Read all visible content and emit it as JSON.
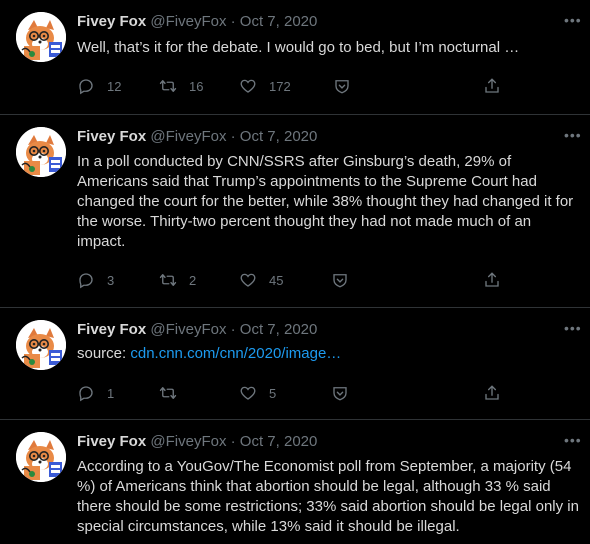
{
  "author": {
    "name": "Fivey Fox",
    "handle": "@FiveyFox",
    "separator": "·"
  },
  "more_glyph": "•••",
  "colors": {
    "background": "#000000",
    "text": "#d9d9d9",
    "muted": "#6e767d",
    "link": "#1d9bf0",
    "divider": "#2f3336"
  },
  "icons": {
    "reply": "reply-icon",
    "retweet": "retweet-icon",
    "like": "heart-icon",
    "save": "shield-icon",
    "share": "share-icon",
    "more": "more-icon"
  },
  "tweets": [
    {
      "date": "Oct 7, 2020",
      "text": "Well, that’s it for the debate. I would go to bed, but I’m nocturnal …",
      "replies": "12",
      "retweets": "16",
      "likes": "172"
    },
    {
      "date": "Oct 7, 2020",
      "text": "In a poll conducted by CNN/SSRS after Ginsburg’s death, 29% of Americans said that Trump’s appointments to the Supreme Court had changed the court for the better, while 38% thought they had changed it for the worse. Thirty-two percent thought they had not made much of an impact.",
      "replies": "3",
      "retweets": "2",
      "likes": "45"
    },
    {
      "date": "Oct 7, 2020",
      "text_prefix": "source: ",
      "link_text": "cdn.cnn.com/cnn/2020/image…",
      "replies": "1",
      "retweets": "",
      "likes": "5"
    },
    {
      "date": "Oct 7, 2020",
      "text": "According to a YouGov/The Economist poll from September, a majority (54 %) of Americans think that abortion should be legal, although 33 % said there should be some restrictions; 33% said abortion should be legal only in special circumstances, while 13% said it should be illegal."
    }
  ]
}
